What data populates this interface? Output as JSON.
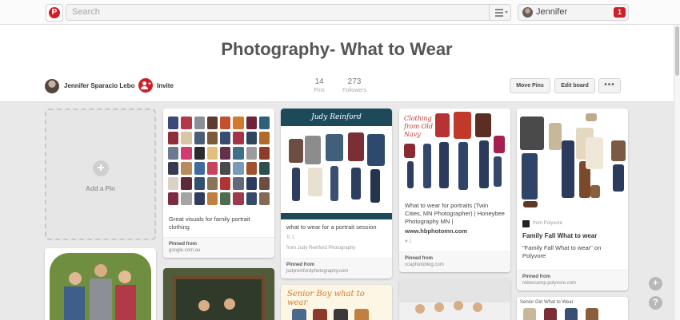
{
  "topbar": {
    "logo": "pinterest-logo",
    "search_placeholder": "Search",
    "user_name": "Jennifer",
    "notification_count": "1"
  },
  "board": {
    "title": "Photography- What to Wear",
    "owner": "Jennifer Sparacio Lebo",
    "invite": "Invite",
    "pins_count": "14",
    "pins_label": "Pins",
    "followers_count": "273",
    "followers_label": "Followers",
    "move_pins": "Move Pins",
    "edit_board": "Edit board",
    "more": "•••"
  },
  "add_pin": {
    "label": "Add a Pin",
    "icon": "plus-icon"
  },
  "pins": [
    {
      "description": "Great visuals for family portrait clothing",
      "pinned_from_label": "Pinned from",
      "pinned_from_site": "google.com.au"
    },
    {
      "image_banner": "Judy Reinford",
      "image_footer": "ALL PIECES FROM OLD NAVY",
      "description": "what to wear for a portrait session",
      "repins": "1",
      "source": "from Judy Reinford Photography",
      "pinned_from_label": "Pinned from",
      "pinned_from_site": "judyreinfordphotography.com"
    },
    {
      "image_title": "Clothing from Old Navy",
      "description": "What to wear for portraits (Twin Cities, MN Photographer) | Honeybee Photography MN |",
      "description_link": "www.hbphotomn.com",
      "likes": "1",
      "pinned_from_label": "Pinned from",
      "pinned_from_site": "ccaphotoblog.com"
    },
    {
      "via": "from Polyvore",
      "title": "Family Fall What to wear",
      "description": "\"Family Fall What to wear\" on Polyvore",
      "pinned_from_label": "Pinned from",
      "pinned_from_site": "rebeccamp.polyvore.com"
    }
  ],
  "lower_pins": [
    {
      "image_title": "Senior Boy what to wear"
    },
    {
      "caption": "Senior Girl What to Wear"
    }
  ],
  "floating": {
    "add": "+",
    "help": "?"
  },
  "colors": {
    "brand_red": "#cb2027",
    "banner_teal": "#1d4a5a"
  }
}
